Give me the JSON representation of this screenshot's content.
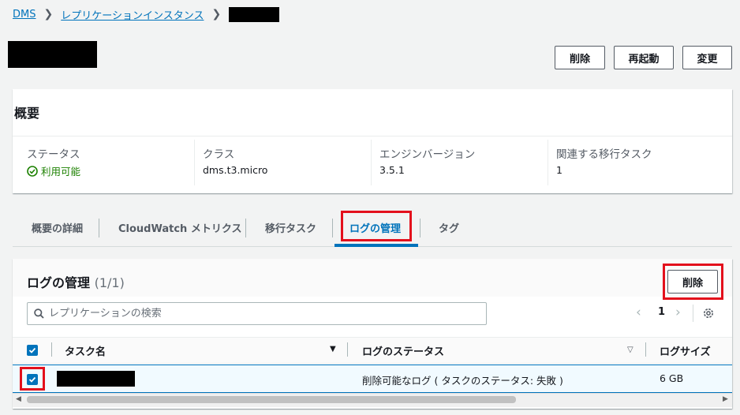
{
  "breadcrumb": {
    "root": "DMS",
    "parent": "レプリケーションインスタンス"
  },
  "header": {
    "buttons": {
      "delete": "削除",
      "reboot": "再起動",
      "modify": "変更"
    }
  },
  "summary": {
    "title": "概要",
    "columns": [
      {
        "label": "ステータス",
        "value": "利用可能"
      },
      {
        "label": "クラス",
        "value": "dms.t3.micro"
      },
      {
        "label": "エンジンバージョン",
        "value": "3.5.1"
      },
      {
        "label": "関連する移行タスク",
        "value": "1"
      }
    ]
  },
  "tabs": [
    {
      "label": "概要の詳細"
    },
    {
      "label": "CloudWatch メトリクス"
    },
    {
      "label": "移行タスク"
    },
    {
      "label": "ログの管理"
    },
    {
      "label": "タグ"
    }
  ],
  "logs": {
    "title": "ログの管理",
    "count": "(1/1)",
    "delete_label": "削除",
    "search_placeholder": "レプリケーションの検索",
    "page": "1",
    "columns": {
      "task_name": "タスク名",
      "log_status": "ログのステータス",
      "log_size": "ログサイズ"
    },
    "rows": [
      {
        "log_status": "削除可能なログ ( タスクのステータス: 失敗 )",
        "log_size": "6 GB"
      }
    ]
  },
  "colors": {
    "accent": "#0073bb",
    "success": "#1d8102",
    "highlight": "#e3101c"
  }
}
